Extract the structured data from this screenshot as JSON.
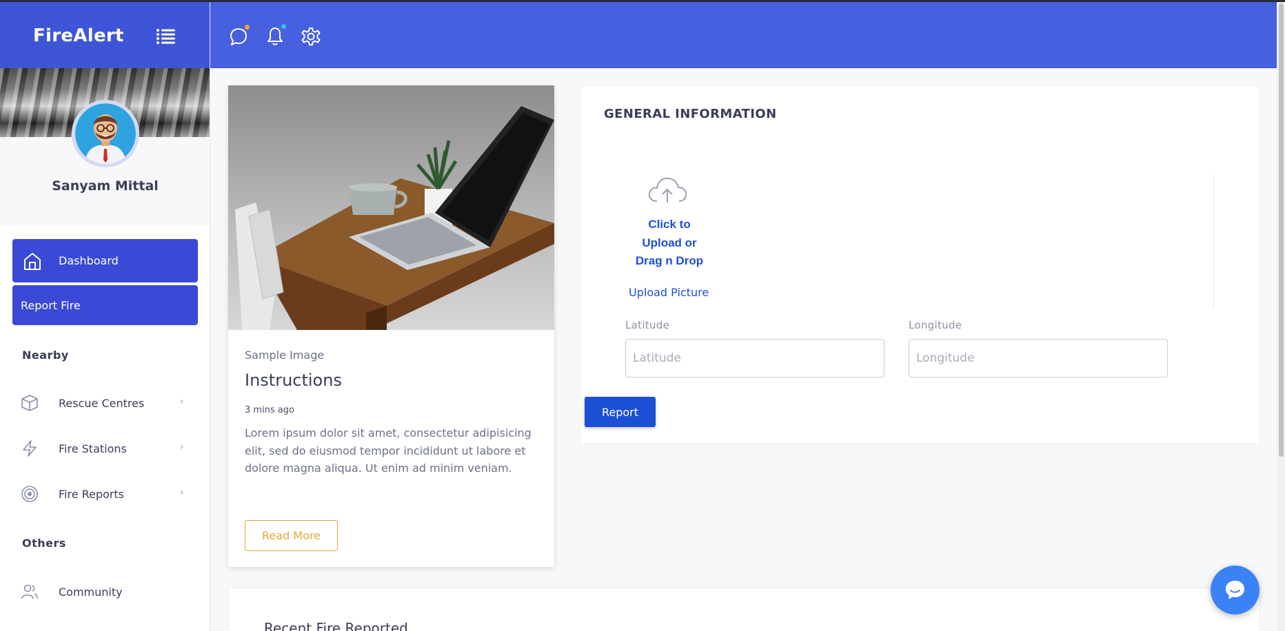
{
  "app": {
    "brand": "FireAlert"
  },
  "sidebar": {
    "user_name": "Sanyam Mittal",
    "primary": [
      {
        "label": "Dashboard",
        "icon": "home-icon"
      },
      {
        "label": "Report Fire"
      }
    ],
    "section_nearby": "Nearby",
    "nearby_items": [
      {
        "label": "Rescue Centres",
        "icon": "cube-icon"
      },
      {
        "label": "Fire Stations",
        "icon": "lightning-icon"
      },
      {
        "label": "Fire Reports",
        "icon": "target-icon"
      }
    ],
    "section_others": "Others",
    "others_items": [
      {
        "label": "Community",
        "icon": "users-icon"
      }
    ]
  },
  "header": {
    "icons": [
      "message-icon",
      "bell-icon",
      "gear-icon"
    ],
    "colors": {
      "bar": "#4760e0",
      "message_dot": "#f5a623",
      "bell_dot": "#2ec4d8"
    }
  },
  "card": {
    "subtitle": "Sample Image",
    "title": "Instructions",
    "time": "3 mins ago",
    "text": "Lorem ipsum dolor sit amet, consectetur adipisicing elit, sed do eiusmod tempor incididunt ut labore et dolore magna aliqua. Ut enim ad minim veniam.",
    "button": "Read More"
  },
  "form": {
    "title": "GENERAL INFORMATION",
    "upload_line1": "Click to",
    "upload_line2": "Upload or",
    "upload_line3": "Drag n Drop",
    "upload_picture": "Upload Picture",
    "latitude_label": "Latitude",
    "latitude_placeholder": "Latitude",
    "longitude_label": "Longitude",
    "longitude_placeholder": "Longitude",
    "submit": "Report"
  },
  "recent": {
    "title": "Recent Fire Reported"
  },
  "colors": {
    "primary": "#3a49d6",
    "accent_blue": "#1c50d4",
    "read_more": "#e3a83a"
  }
}
